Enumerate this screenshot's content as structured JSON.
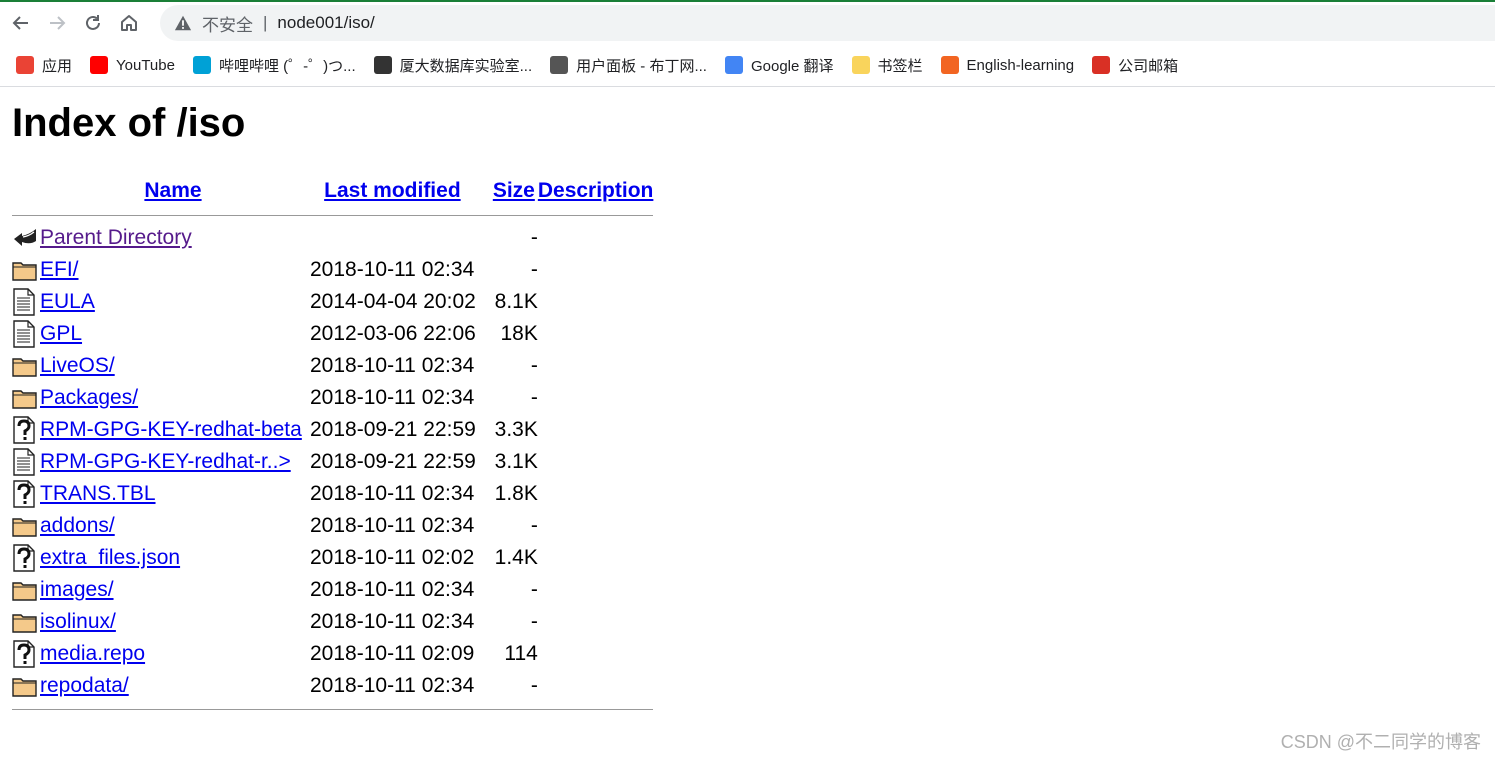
{
  "browser": {
    "insecure_label": "不安全",
    "url": "node001/iso/"
  },
  "bookmarks": [
    {
      "label": "应用",
      "icon": "apps-grid-icon",
      "color": "#ea4335"
    },
    {
      "label": "YouTube",
      "icon": "youtube-icon",
      "color": "#ff0000"
    },
    {
      "label": "哔哩哔哩 (゜-゜)つ...",
      "icon": "bilibili-icon",
      "color": "#00a1d6"
    },
    {
      "label": "厦大数据库实验室...",
      "icon": "dblab-icon",
      "color": "#333333"
    },
    {
      "label": "用户面板 - 布丁网...",
      "icon": "pudding-icon",
      "color": "#555555"
    },
    {
      "label": "Google 翻译",
      "icon": "google-translate-icon",
      "color": "#4285f4"
    },
    {
      "label": "书签栏",
      "icon": "folder-icon",
      "color": "#f9d45c"
    },
    {
      "label": "English-learning",
      "icon": "english-learning-icon",
      "color": "#f26522"
    },
    {
      "label": "公司邮箱",
      "icon": "mail-icon",
      "color": "#d93025"
    }
  ],
  "page": {
    "title": "Index of /iso",
    "columns": {
      "name": "Name",
      "last_modified": "Last modified",
      "size": "Size",
      "description": "Description"
    },
    "rows": [
      {
        "icon": "back",
        "name": "Parent Directory",
        "date": "",
        "size": "-",
        "visited": true
      },
      {
        "icon": "folder",
        "name": "EFI/",
        "date": "2018-10-11 02:34",
        "size": "-"
      },
      {
        "icon": "text",
        "name": "EULA",
        "date": "2014-04-04 20:02",
        "size": "8.1K"
      },
      {
        "icon": "text",
        "name": "GPL",
        "date": "2012-03-06 22:06",
        "size": "18K"
      },
      {
        "icon": "folder",
        "name": "LiveOS/",
        "date": "2018-10-11 02:34",
        "size": "-"
      },
      {
        "icon": "folder",
        "name": "Packages/",
        "date": "2018-10-11 02:34",
        "size": "-"
      },
      {
        "icon": "unknown",
        "name": "RPM-GPG-KEY-redhat-beta",
        "date": "2018-09-21 22:59",
        "size": "3.3K"
      },
      {
        "icon": "text",
        "name": "RPM-GPG-KEY-redhat-r..>",
        "date": "2018-09-21 22:59",
        "size": "3.1K"
      },
      {
        "icon": "unknown",
        "name": "TRANS.TBL",
        "date": "2018-10-11 02:34",
        "size": "1.8K"
      },
      {
        "icon": "folder",
        "name": "addons/",
        "date": "2018-10-11 02:34",
        "size": "-"
      },
      {
        "icon": "unknown",
        "name": "extra_files.json",
        "date": "2018-10-11 02:02",
        "size": "1.4K"
      },
      {
        "icon": "folder",
        "name": "images/",
        "date": "2018-10-11 02:34",
        "size": "-"
      },
      {
        "icon": "folder",
        "name": "isolinux/",
        "date": "2018-10-11 02:34",
        "size": "-"
      },
      {
        "icon": "unknown",
        "name": "media.repo",
        "date": "2018-10-11 02:09",
        "size": "114"
      },
      {
        "icon": "folder",
        "name": "repodata/",
        "date": "2018-10-11 02:34",
        "size": "-"
      }
    ]
  },
  "watermark": "CSDN @不二同学的博客"
}
